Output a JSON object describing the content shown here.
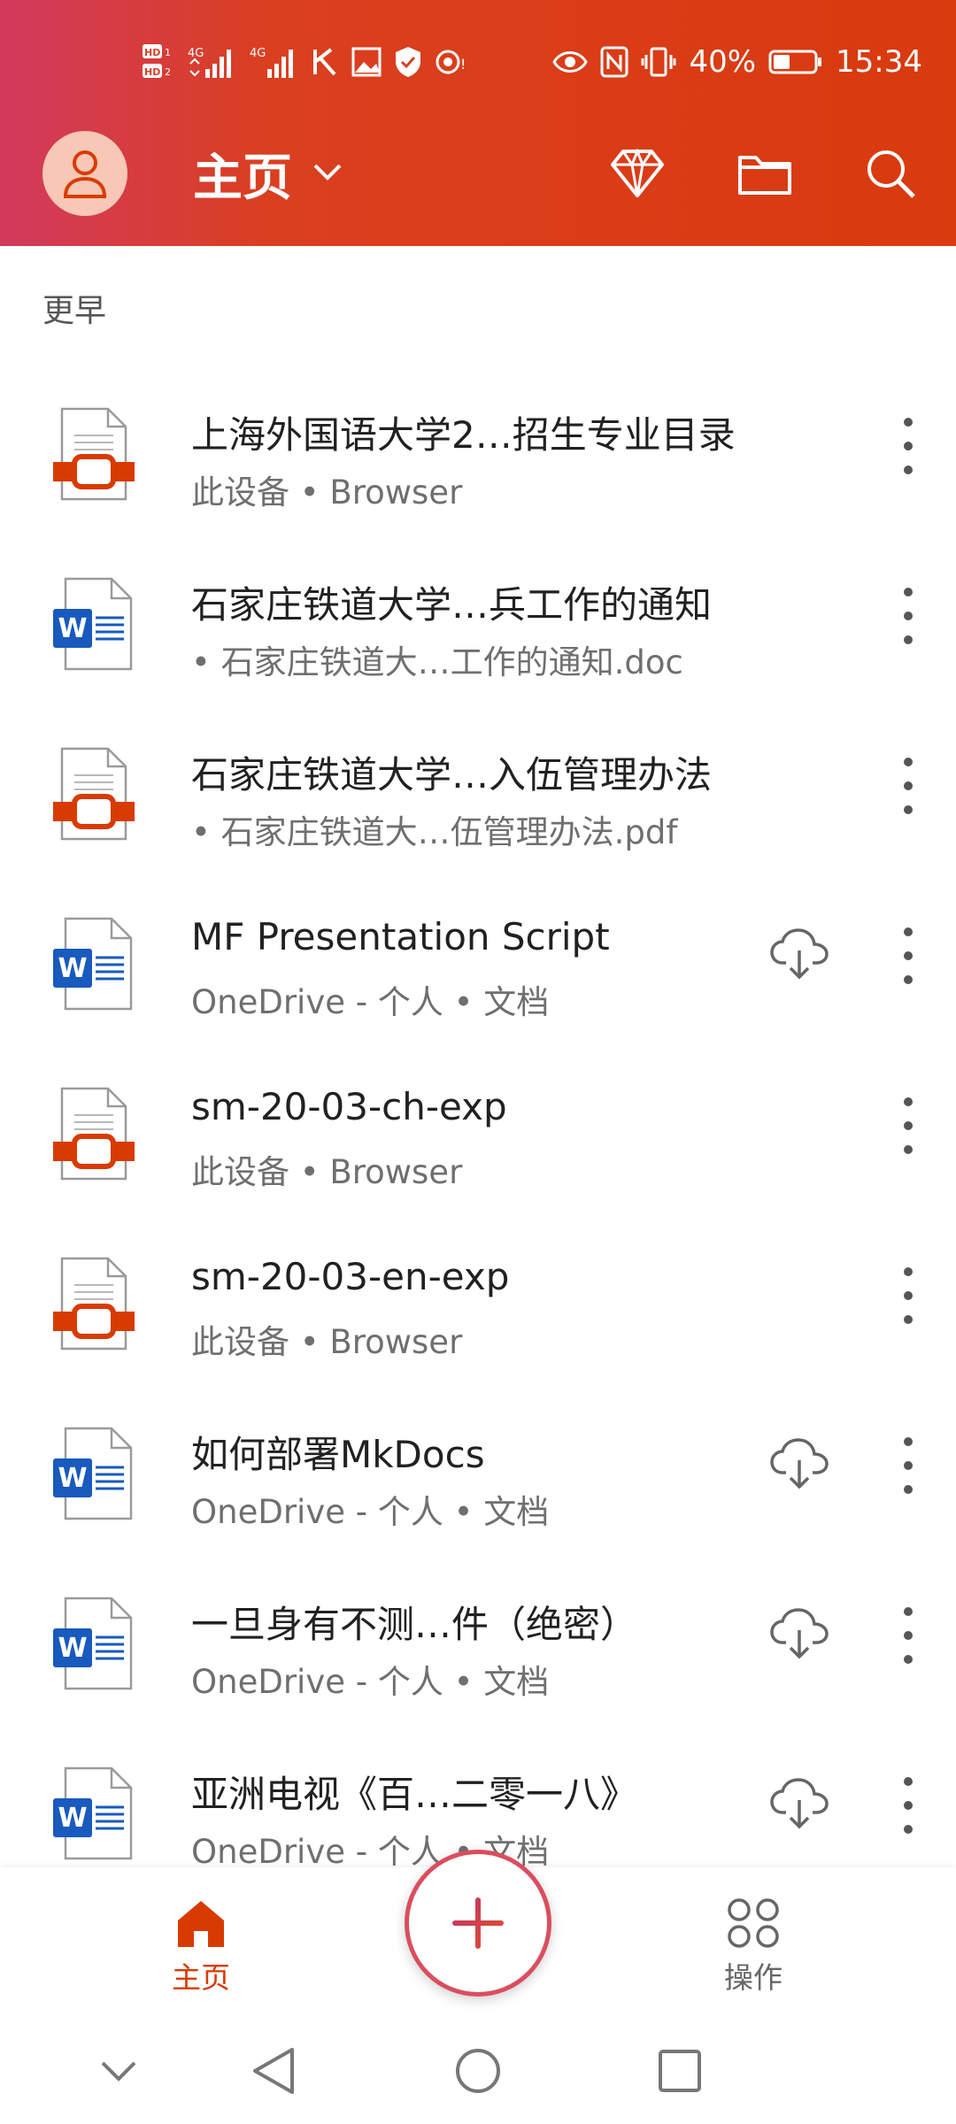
{
  "status_bar": {
    "hd1": "HD1",
    "hd2": "HD2",
    "signal1": "4G",
    "signal2": "4G",
    "battery_pct": "40%",
    "time": "15:34"
  },
  "app_bar": {
    "title": "主页"
  },
  "section": {
    "title": "更早"
  },
  "files": [
    {
      "name": "上海外国语大学2…招生专业目录",
      "sub": "此设备 • Browser",
      "type": "pdf",
      "cloud": false
    },
    {
      "name": "石家庄铁道大学…兵工作的通知",
      "sub": "• 石家庄铁道大…工作的通知.doc",
      "type": "word",
      "cloud": false
    },
    {
      "name": "石家庄铁道大学…入伍管理办法",
      "sub": "• 石家庄铁道大…伍管理办法.pdf",
      "type": "pdf",
      "cloud": false
    },
    {
      "name": "MF Presentation Script",
      "sub": "OneDrive - 个人 • 文档",
      "type": "word",
      "cloud": true
    },
    {
      "name": "sm-20-03-ch-exp",
      "sub": "此设备 • Browser",
      "type": "pdf",
      "cloud": false
    },
    {
      "name": "sm-20-03-en-exp",
      "sub": "此设备 • Browser",
      "type": "pdf",
      "cloud": false
    },
    {
      "name": "如何部署MkDocs",
      "sub": "OneDrive - 个人 • 文档",
      "type": "word",
      "cloud": true
    },
    {
      "name": "一旦身有不测…件（绝密）",
      "sub": "OneDrive - 个人 • 文档",
      "type": "word",
      "cloud": true
    },
    {
      "name": "亚洲电视《百…二零一八》",
      "sub": "OneDrive - 个人 • 文档",
      "type": "word",
      "cloud": true
    }
  ],
  "bottom_nav": {
    "home_label": "主页",
    "actions_label": "操作"
  },
  "colors": {
    "brand": "#d83b01",
    "active_tab": "#d83b01",
    "word_blue": "#185abd"
  },
  "icons": {
    "premium": "diamond-icon",
    "folder": "folder-icon",
    "search": "search-icon",
    "cloud": "cloud-download-icon",
    "more": "more-vertical-icon"
  }
}
